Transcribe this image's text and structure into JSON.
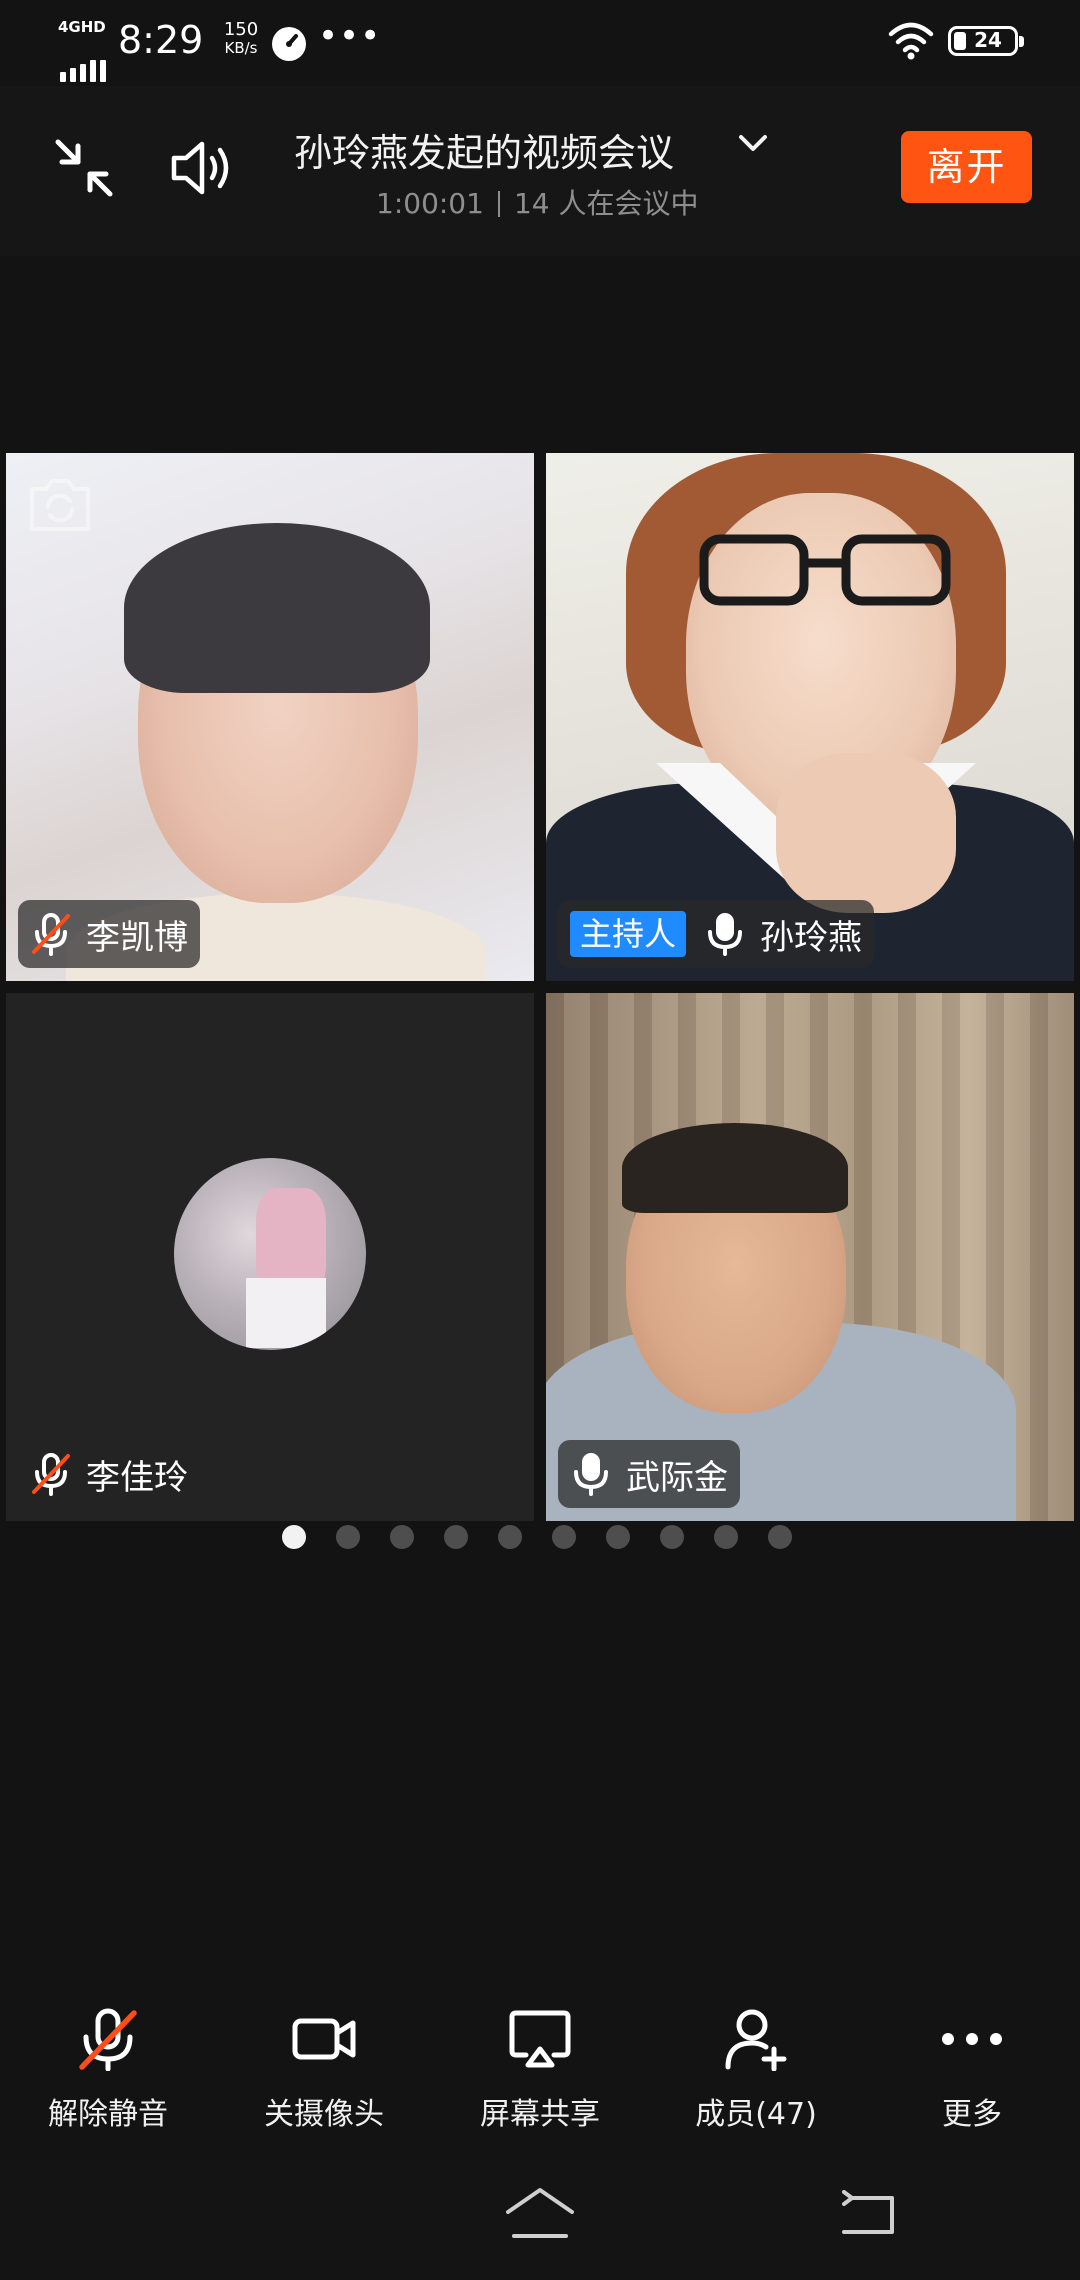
{
  "status_bar": {
    "network": "4GHD",
    "time": "8:29",
    "speed_value": "150",
    "speed_unit": "KB/s",
    "more": "•••",
    "battery": "24"
  },
  "header": {
    "title": "孙玲燕发起的视频会议",
    "duration": "1:00:01",
    "participants_text": "14 人在会议中",
    "leave_label": "离开"
  },
  "participants": [
    {
      "name": "李凯博",
      "mic": "muted"
    },
    {
      "name": "孙玲燕",
      "mic": "on",
      "role_badge": "主持人"
    },
    {
      "name": "李佳玲",
      "mic": "muted"
    },
    {
      "name": "武际金",
      "mic": "on"
    }
  ],
  "pager": {
    "pages": 10,
    "current": 1
  },
  "toolbar": {
    "unmute_label": "解除静音",
    "camera_off_label": "关摄像头",
    "screen_share_label": "屏幕共享",
    "members_label": "成员(47)",
    "more_label": "更多"
  },
  "colors": {
    "leave_button": "#ff5412",
    "host_badge": "#1f8bff",
    "mute_slash": "#ff4d1a",
    "background": "#131313"
  },
  "icons": {
    "collapse": "collapse-arrows-icon",
    "speaker": "speaker-icon",
    "chevron": "chevron-down-icon",
    "mic_muted": "mic-muted-icon",
    "mic": "mic-icon",
    "camera_switch": "camera-switch-icon",
    "camera": "video-camera-icon",
    "screen_share": "screen-share-icon",
    "members": "add-member-icon",
    "more": "more-dots-icon",
    "home": "home-icon",
    "back": "back-icon"
  }
}
